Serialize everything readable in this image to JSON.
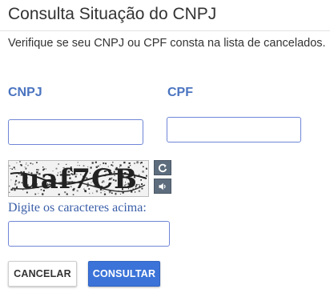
{
  "header": {
    "title": "Consulta Situação do CNPJ",
    "subtitle": "Verifique se seu CNPJ ou CPF consta na lista de cancelados."
  },
  "form": {
    "cnpj_label": "CNPJ",
    "cnpj_value": "",
    "cpf_label": "CPF",
    "cpf_value": "",
    "captcha": {
      "text": "uaf7CB",
      "refresh_icon": "refresh-icon",
      "audio_icon": "speaker-icon",
      "hint": "Digite os caracteres acima:",
      "input_value": ""
    }
  },
  "actions": {
    "cancel_label": "CANCELAR",
    "submit_label": "CONSULTAR"
  },
  "colors": {
    "label_blue": "#4a74c0",
    "hint_blue": "#3a5ea8",
    "input_border": "#6f86d6",
    "submit_bg": "#3b73d8",
    "control_gray": "#5d6d7e"
  }
}
